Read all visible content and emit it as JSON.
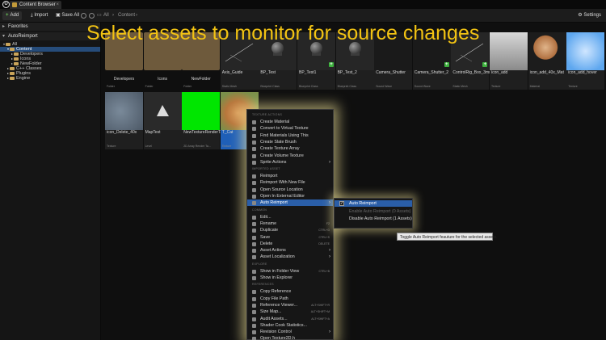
{
  "window": {
    "tab_label": "Content Browser",
    "tab_close": "×"
  },
  "toolbar": {
    "add_label": "Add",
    "import_label": "Import",
    "save_all_label": "Save All",
    "breadcrumb": [
      "All",
      "Content"
    ],
    "settings_label": "Settings"
  },
  "sidebar": {
    "favorites_header": "Favorites",
    "project_header": "AutoReimport",
    "tree": [
      {
        "label": "All",
        "indent": 0,
        "selected": false
      },
      {
        "label": "Content",
        "indent": 1,
        "selected": true
      },
      {
        "label": "Developers",
        "indent": 2,
        "selected": false
      },
      {
        "label": "Icons",
        "indent": 2,
        "selected": false
      },
      {
        "label": "NewFolder",
        "indent": 2,
        "selected": false
      },
      {
        "label": "C++ Classes",
        "indent": 1,
        "selected": false
      },
      {
        "label": "Plugins",
        "indent": 1,
        "selected": false
      },
      {
        "label": "Engine",
        "indent": 1,
        "selected": false
      }
    ]
  },
  "headline": "Select assets to monitor for source changes",
  "assets_row1": [
    {
      "name": "Developers",
      "type": "Folder",
      "kind": "folder"
    },
    {
      "name": "Icons",
      "type": "Folder",
      "kind": "folder"
    },
    {
      "name": "NewFolder",
      "type": "Folder",
      "kind": "folder"
    },
    {
      "name": "Axis_Guide",
      "type": "Static Mesh",
      "kind": "mesh"
    },
    {
      "name": "BP_Test",
      "type": "Blueprint Class",
      "kind": "sphere"
    },
    {
      "name": "BP_Test1",
      "type": "Blueprint Class",
      "kind": "sphere",
      "plus": true
    },
    {
      "name": "BP_Test_2",
      "type": "Blueprint Class",
      "kind": "sphere"
    },
    {
      "name": "Camera_Shutter",
      "type": "Sound Wave",
      "kind": "dark"
    },
    {
      "name": "Camera_Shutter_2",
      "type": "Sound Wave",
      "kind": "dark",
      "plus": true
    },
    {
      "name": "ControlRig_Box_3mm",
      "type": "Static Mesh",
      "kind": "mesh",
      "plus": true
    },
    {
      "name": "icon_add",
      "type": "Texture",
      "kind": "gray"
    },
    {
      "name": "icon_add_40x_Mat",
      "type": "Material",
      "kind": "orb"
    },
    {
      "name": "icon_add_hover",
      "type": "Texture",
      "kind": "blue"
    }
  ],
  "assets_row2": [
    {
      "name": "icon_Delete_40x",
      "type": "Texture",
      "kind": "trash"
    },
    {
      "name": "MapTest",
      "type": "Level",
      "kind": "map"
    },
    {
      "name": "NewTextureRenderTarget2DArray",
      "type": "2D Array Render Ta...",
      "kind": "green"
    },
    {
      "name": "T_Cat",
      "type": "Texture",
      "kind": "cat"
    }
  ],
  "context_menu": {
    "sections": [
      {
        "title": "TEXTURE ACTIONS",
        "items": [
          {
            "label": "Create Material"
          },
          {
            "label": "Convert to Virtual Texture"
          },
          {
            "label": "Find Materials Using This"
          },
          {
            "label": "Create Slate Brush"
          },
          {
            "label": "Create Texture Array"
          },
          {
            "label": "Create Volume Texture"
          },
          {
            "label": "Sprite Actions",
            "submenu": true
          }
        ]
      },
      {
        "title": "IMPORTED ASSET",
        "items": [
          {
            "label": "Reimport"
          },
          {
            "label": "Reimport With New File"
          },
          {
            "label": "Open Source Location"
          },
          {
            "label": "Open In External Editor"
          },
          {
            "label": "Auto Reimport",
            "submenu": true,
            "highlighted": true
          }
        ]
      },
      {
        "title": "COMMON",
        "items": [
          {
            "label": "Edit..."
          },
          {
            "label": "Rename",
            "shortcut": "F2"
          },
          {
            "label": "Duplicate",
            "shortcut": "CTRL+D"
          },
          {
            "label": "Save",
            "shortcut": "CTRL+S"
          },
          {
            "label": "Delete",
            "shortcut": "DELETE"
          },
          {
            "label": "Asset Actions",
            "submenu": true
          },
          {
            "label": "Asset Localization",
            "submenu": true
          }
        ]
      },
      {
        "title": "EXPLORE",
        "items": [
          {
            "label": "Show in Folder View",
            "shortcut": "CTRL+B"
          },
          {
            "label": "Show in Explorer"
          }
        ]
      },
      {
        "title": "REFERENCES",
        "items": [
          {
            "label": "Copy Reference"
          },
          {
            "label": "Copy File Path"
          },
          {
            "label": "Reference Viewer...",
            "shortcut": "ALT+SHIFT+R"
          },
          {
            "label": "Size Map...",
            "shortcut": "ALT+SHIFT+M"
          },
          {
            "label": "Audit Assets...",
            "shortcut": "ALT+SHIFT+A"
          },
          {
            "label": "Shader Cook Statistics..."
          },
          {
            "label": "Revision Control",
            "submenu": true
          },
          {
            "label": "Open Texture2D.h"
          }
        ]
      }
    ]
  },
  "submenu": {
    "items": [
      {
        "label": "Auto Reimport",
        "checked": true,
        "highlighted": true
      },
      {
        "label": "Enable Auto Reimport (0 Assets)",
        "disabled": true
      },
      {
        "label": "Disable Auto Reimport (1 Assets)"
      }
    ]
  },
  "tooltip": "Toggle Auto Reimport feauture for the selected assets."
}
